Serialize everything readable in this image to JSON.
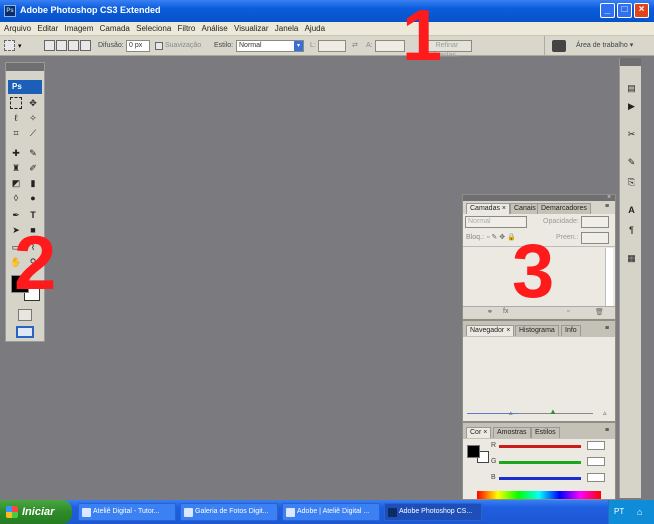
{
  "window": {
    "title": "Adobe Photoshop CS3 Extended",
    "app_icon": "ps-icon",
    "controls": [
      "minimize-icon",
      "maximize-icon",
      "close-icon"
    ]
  },
  "menu": [
    "Arquivo",
    "Editar",
    "Imagem",
    "Camada",
    "Seleciona",
    "Filtro",
    "Análise",
    "Visualizar",
    "Janela",
    "Ajuda"
  ],
  "options_bar": {
    "feather_label": "Difusão:",
    "feather_value": "0 px",
    "antialias_label": "Suavização",
    "style_label": "Estilo:",
    "style_value": "Normal",
    "width_label": "L:",
    "height_label": "A:",
    "refine_button": "Refinar Arestas...",
    "workspace_label": "Área de trabalho ▾"
  },
  "toolbox": {
    "logo": "Ps",
    "tools": [
      "marquee-icon",
      "move-icon",
      "lasso-icon",
      "magic-wand-icon",
      "crop-icon",
      "slice-icon",
      "healing-icon",
      "brush-icon",
      "stamp-icon",
      "history-brush-icon",
      "eraser-icon",
      "gradient-icon",
      "blur-icon",
      "dodge-icon",
      "pen-icon",
      "type-icon",
      "path-select-icon",
      "shape-icon",
      "notes-icon",
      "eyedropper-icon",
      "hand-icon",
      "zoom-icon"
    ]
  },
  "panel_layers": {
    "tabs": [
      "Camadas",
      "Canais",
      "Demarcadores"
    ],
    "blend_mode": "Normal",
    "opacity_label": "Opacidade:",
    "lock_label": "Bloq.:",
    "fill_label": "Preen.:"
  },
  "panel_navigator": {
    "tabs": [
      "Navegador",
      "Histograma",
      "Info"
    ]
  },
  "panel_color": {
    "tabs": [
      "Cor",
      "Amostras",
      "Estilos"
    ],
    "channels": [
      "R",
      "G",
      "B"
    ],
    "channel_colors": [
      "#cc1b1b",
      "#1aa61a",
      "#1b2fd0"
    ]
  },
  "overlay_numbers": [
    "1",
    "2",
    "3"
  ],
  "taskbar": {
    "start_label": "Iniciar",
    "items": [
      "Ateliê Digital - Tutor...",
      "Galeria de Fotos Digit...",
      "Adobe | Ateliê Digital ...",
      "Adobe Photoshop CS..."
    ],
    "active_index": 3,
    "tray_text": "PT"
  }
}
